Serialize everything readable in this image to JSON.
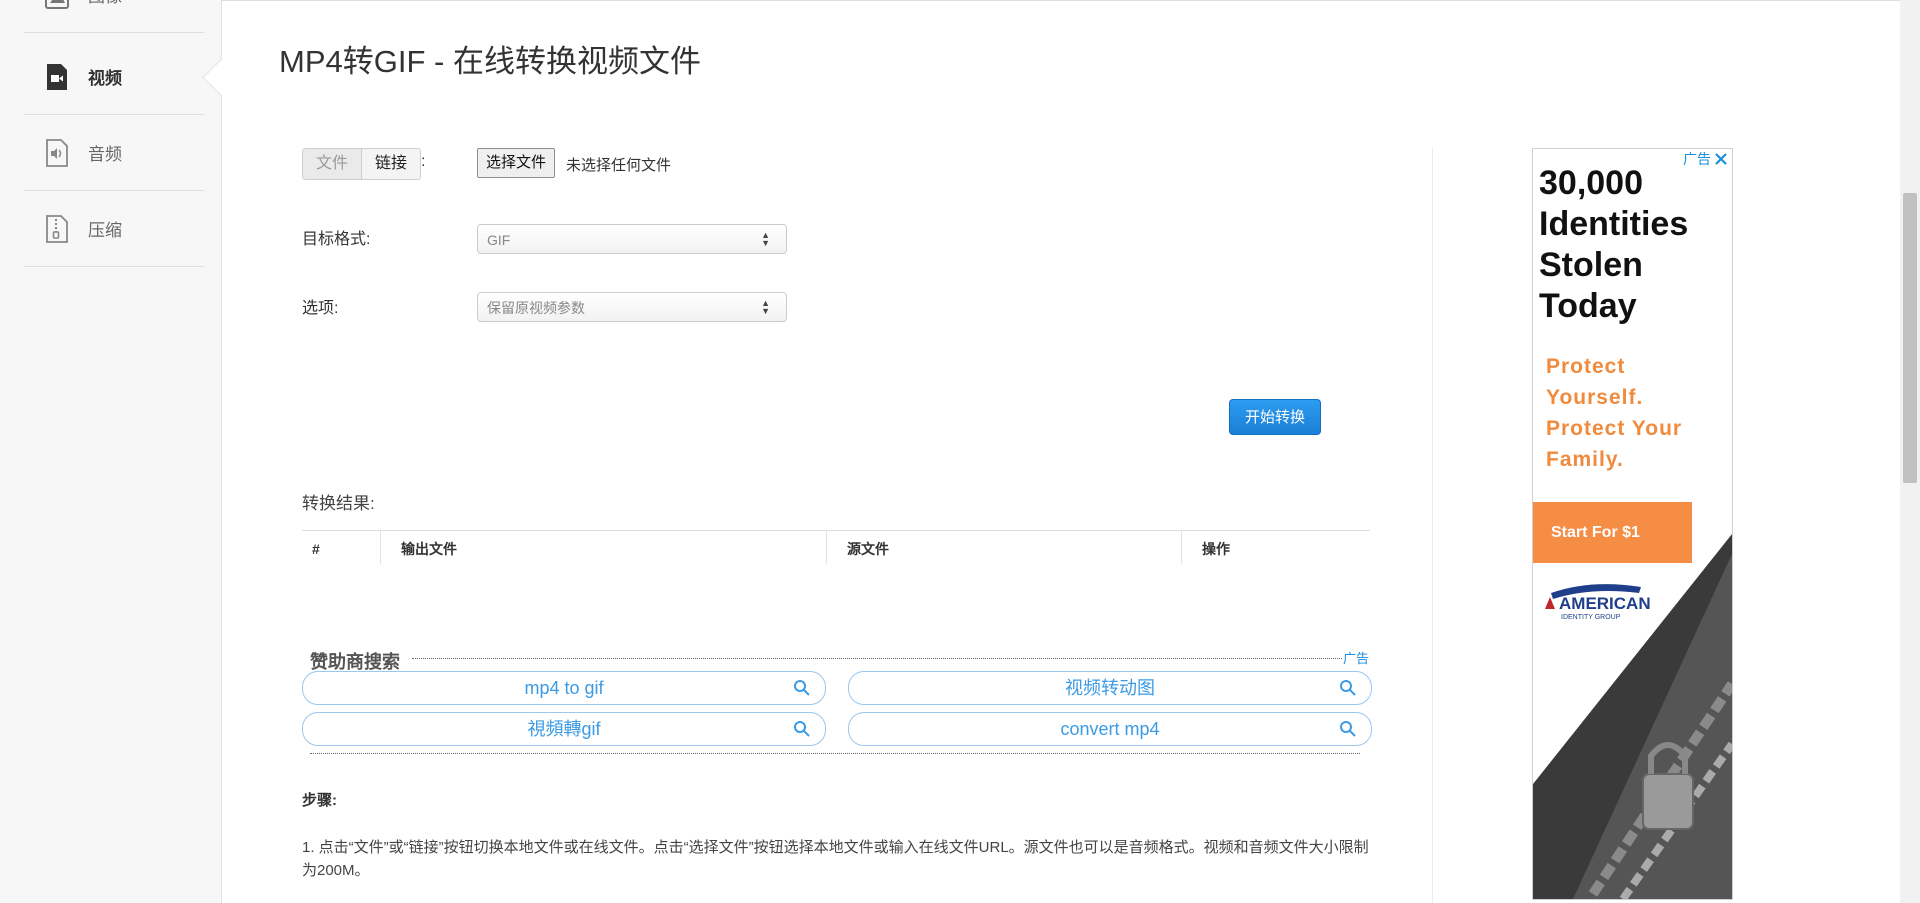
{
  "sidebar": {
    "items": [
      {
        "label": "图像",
        "icon": "image-icon"
      },
      {
        "label": "视频",
        "icon": "video-icon",
        "active": true
      },
      {
        "label": "音频",
        "icon": "audio-file-icon"
      },
      {
        "label": "压缩",
        "icon": "zip-file-icon"
      }
    ]
  },
  "page": {
    "title": "MP4转GIF - 在线转换视频文件"
  },
  "form": {
    "source_tabs": [
      "文件",
      "链接"
    ],
    "colon": ":",
    "file_button": "选择文件",
    "no_file_text": "未选择任何文件",
    "target_format_label": "目标格式:",
    "target_format_value": "GIF",
    "options_label": "选项:",
    "options_value": "保留原视频参数",
    "start_button": "开始转换"
  },
  "results": {
    "label": "转换结果:",
    "columns": [
      "#",
      "输出文件",
      "源文件",
      "操作"
    ]
  },
  "sponsor": {
    "title": "赞助商搜索",
    "ad_label": "广告",
    "chips": [
      "mp4 to gif",
      "视频转动图",
      "視頻轉gif",
      "convert mp4"
    ]
  },
  "steps": {
    "title": "步骤:",
    "step1": "1. 点击“文件”或“链接”按钮切换本地文件或在线文件。点击“选择文件”按钮选择本地文件或输入在线文件URL。源文件也可以是音频格式。视频和音频文件大小限制为200M。"
  },
  "ad": {
    "tag": "广告",
    "headline": [
      "30,000",
      "Identities",
      "Stolen",
      "Today"
    ],
    "sub": [
      "Protect",
      "Yourself.",
      "Protect Your",
      "Family."
    ],
    "button": "Start For $1",
    "logo_line1": "AMERICAN",
    "logo_line2": "IDENTITY GROUP"
  },
  "colors": {
    "accent": "#1a8fe0",
    "start_button": "#1a7fd6",
    "ad_orange": "#f58d45"
  }
}
